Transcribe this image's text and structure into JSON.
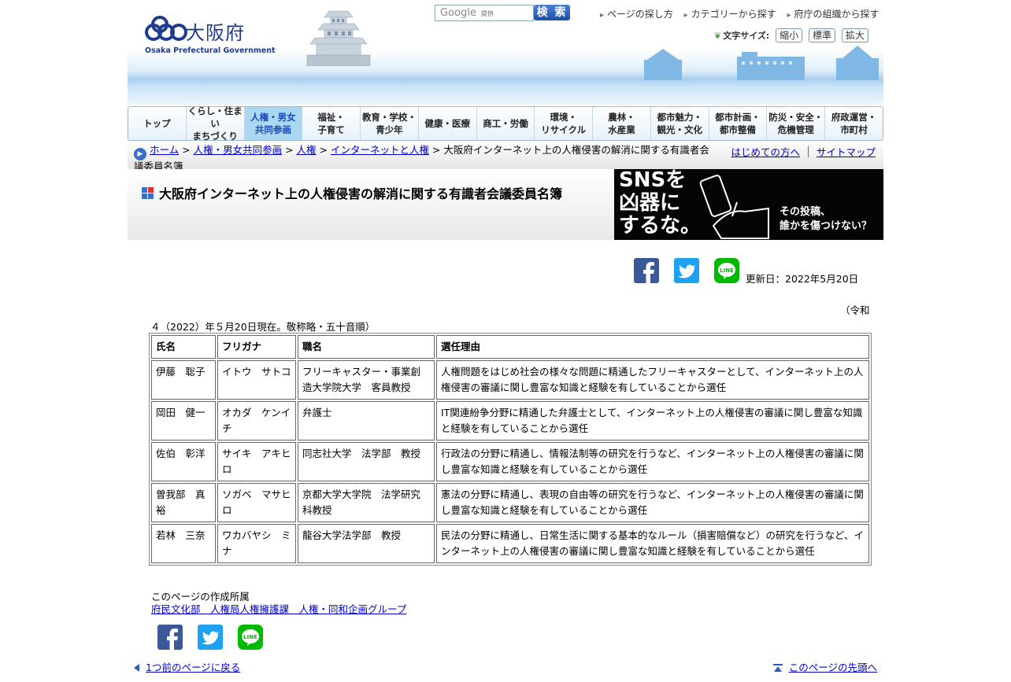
{
  "header": {
    "logo_jp": "大阪府",
    "logo_en": "Osaka Prefectural Government",
    "search_placeholder": "Google",
    "search_provided": "提供",
    "search_button": "検 索",
    "links": [
      "ページの探し方",
      "カテゴリーから探す",
      "府庁の組織から探す"
    ],
    "font_size_label": "文字サイズ:",
    "font_buttons": [
      "縮小",
      "標準",
      "拡大"
    ]
  },
  "nav": [
    {
      "line1": "トップ",
      "line2": ""
    },
    {
      "line1": "くらし・住まい",
      "line2": "まちづくり"
    },
    {
      "line1": "人権・男女",
      "line2": "共同参画"
    },
    {
      "line1": "福祉・",
      "line2": "子育て"
    },
    {
      "line1": "教育・学校・",
      "line2": "青少年"
    },
    {
      "line1": "健康・医療",
      "line2": ""
    },
    {
      "line1": "商工・労働",
      "line2": ""
    },
    {
      "line1": "環境・",
      "line2": "リサイクル"
    },
    {
      "line1": "農林・",
      "line2": "水産業"
    },
    {
      "line1": "都市魅力・",
      "line2": "観光・文化"
    },
    {
      "line1": "都市計画・",
      "line2": "都市整備"
    },
    {
      "line1": "防災・安全・",
      "line2": "危機管理"
    },
    {
      "line1": "府政運営・",
      "line2": "市町村"
    }
  ],
  "breadcrumb": {
    "items": [
      "ホーム",
      "人権・男女共同参画",
      "人権",
      "インターネットと人権"
    ],
    "current": "大阪府インターネット上の人権侵害の解消に関する有識者会議委員名簿",
    "first_time": "はじめての方へ",
    "sitemap": "サイトマップ"
  },
  "page_title": "大阪府インターネット上の人権侵害の解消に関する有識者会議委員名簿",
  "banner": {
    "line1": "SNSを",
    "line2": "凶器に",
    "line3": "するな。",
    "sub1": "その投稿、",
    "sub2": "誰かを傷つけない？"
  },
  "updated": "更新日：2022年5月20日",
  "note_line1": "（令和",
  "note_line2": "４（2022）年５月20日現在。敬称略・五十音順）",
  "table": {
    "headers": [
      "氏名",
      "フリガナ",
      "職名",
      "選任理由"
    ],
    "rows": [
      [
        "伊藤　聡子",
        "イトウ　サトコ",
        "フリーキャスター・事業創造大学院大学　客員教授",
        "人権問題をはじめ社会の様々な問題に精通したフリーキャスターとして、インターネット上の人権侵害の審議に関し豊富な知識と経験を有していることから選任"
      ],
      [
        "岡田　健一",
        "オカダ　ケンイチ",
        "弁護士",
        "IT関連紛争分野に精通した弁護士として、インターネット上の人権侵害の審議に関し豊富な知識と経験を有していることから選任"
      ],
      [
        "佐伯　彰洋",
        "サイキ　アキヒロ",
        "同志社大学　法学部　教授",
        "行政法の分野に精通し、情報法制等の研究を行うなど、インターネット上の人権侵害の審議に関し豊富な知識と経験を有していることから選任"
      ],
      [
        "曽我部　真裕",
        "ソガベ　マサヒロ",
        "京都大学大学院　法学研究科教授",
        "憲法の分野に精通し、表現の自由等の研究を行うなど、インターネット上の人権侵害の審議に関し豊富な知識と経験を有していることから選任"
      ],
      [
        "若林　三奈",
        "ワカバヤシ　ミナ",
        "龍谷大学法学部　教授",
        "民法の分野に精通し、日常生活に関する基本的なルール（損害賠償など）の研究を行うなど、インターネット上の人権侵害の審議に関し豊富な知識と経験を有していることから選任"
      ]
    ]
  },
  "footer": {
    "dept_label": "このページの作成所属",
    "dept_link": "府民文化部　人権局人権擁護課　人権・同和企画グループ",
    "back": "1つ前のページに戻る",
    "top": "このページの先頭へ"
  },
  "colors": {
    "facebook": "#3b5998",
    "twitter": "#1da1f2",
    "line": "#00b900",
    "accent": "#1f3b8f"
  }
}
